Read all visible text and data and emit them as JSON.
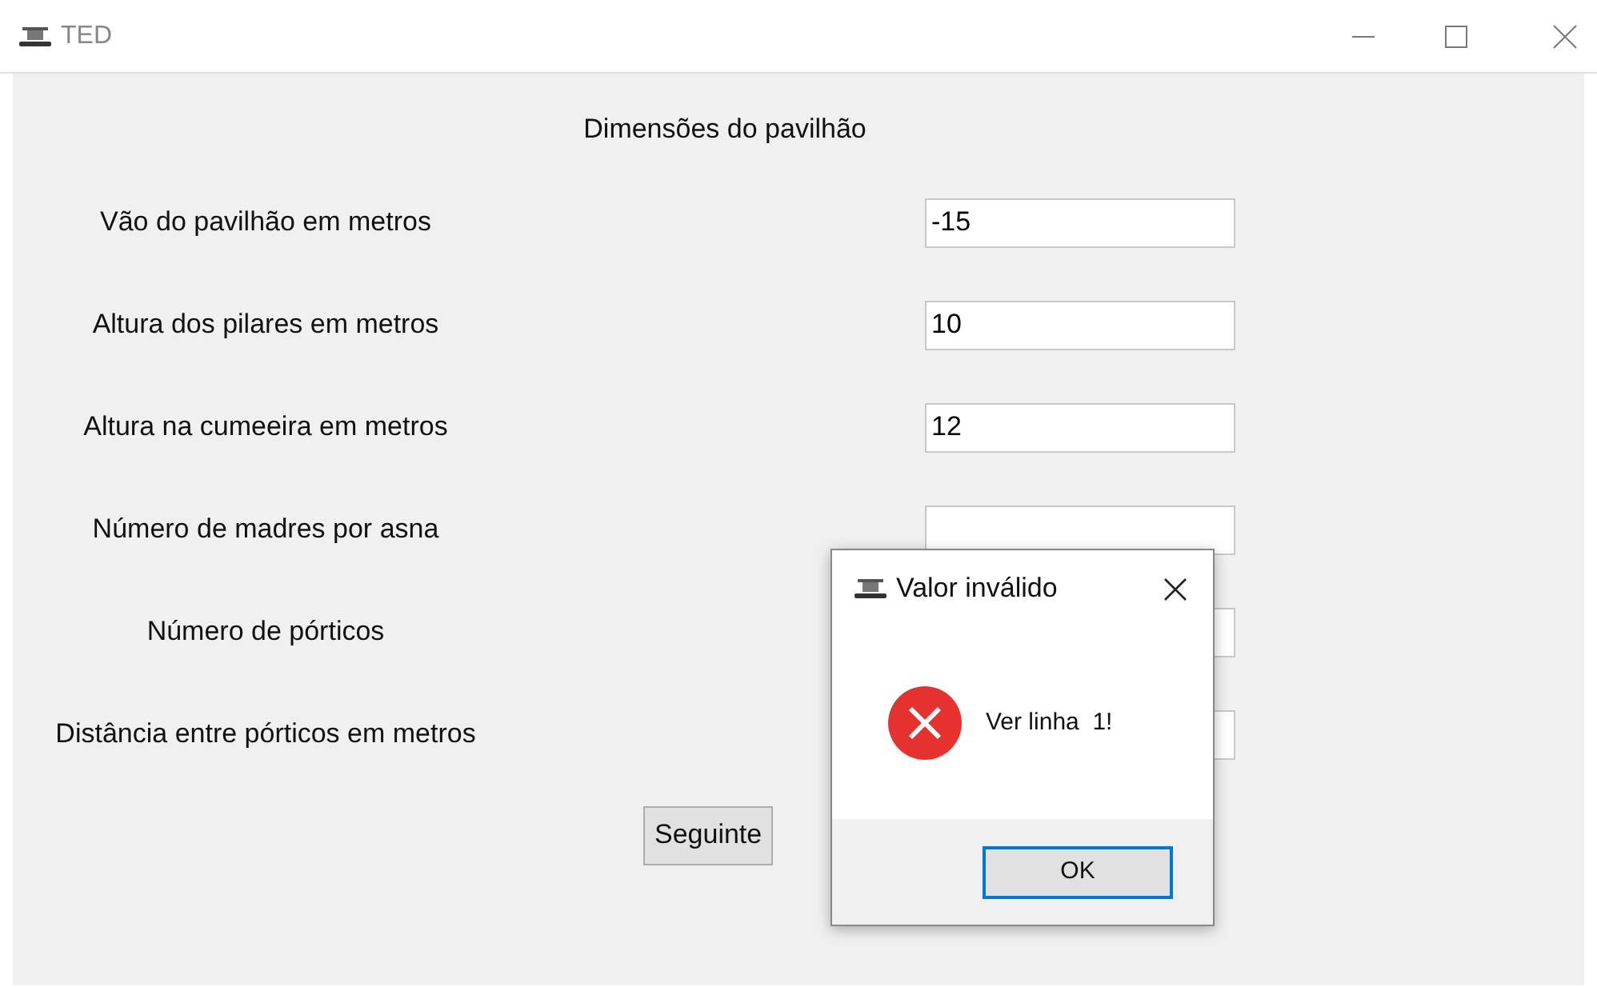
{
  "window": {
    "title": "TED"
  },
  "heading": "Dimensões do pavilhão",
  "fields": [
    {
      "label": "Vão do pavilhão em metros",
      "value": "-15"
    },
    {
      "label": "Altura dos pilares em metros",
      "value": "10"
    },
    {
      "label": "Altura na cumeeira em metros",
      "value": "12"
    },
    {
      "label": "Número de madres por asna"
    },
    {
      "label": "Número de pórticos"
    },
    {
      "label": "Distância entre pórticos em metros"
    }
  ],
  "next_button": "Seguinte",
  "dialog": {
    "title": "Valor inválido",
    "kind": "error",
    "message": "Ver linha  1!",
    "button": "OK"
  }
}
